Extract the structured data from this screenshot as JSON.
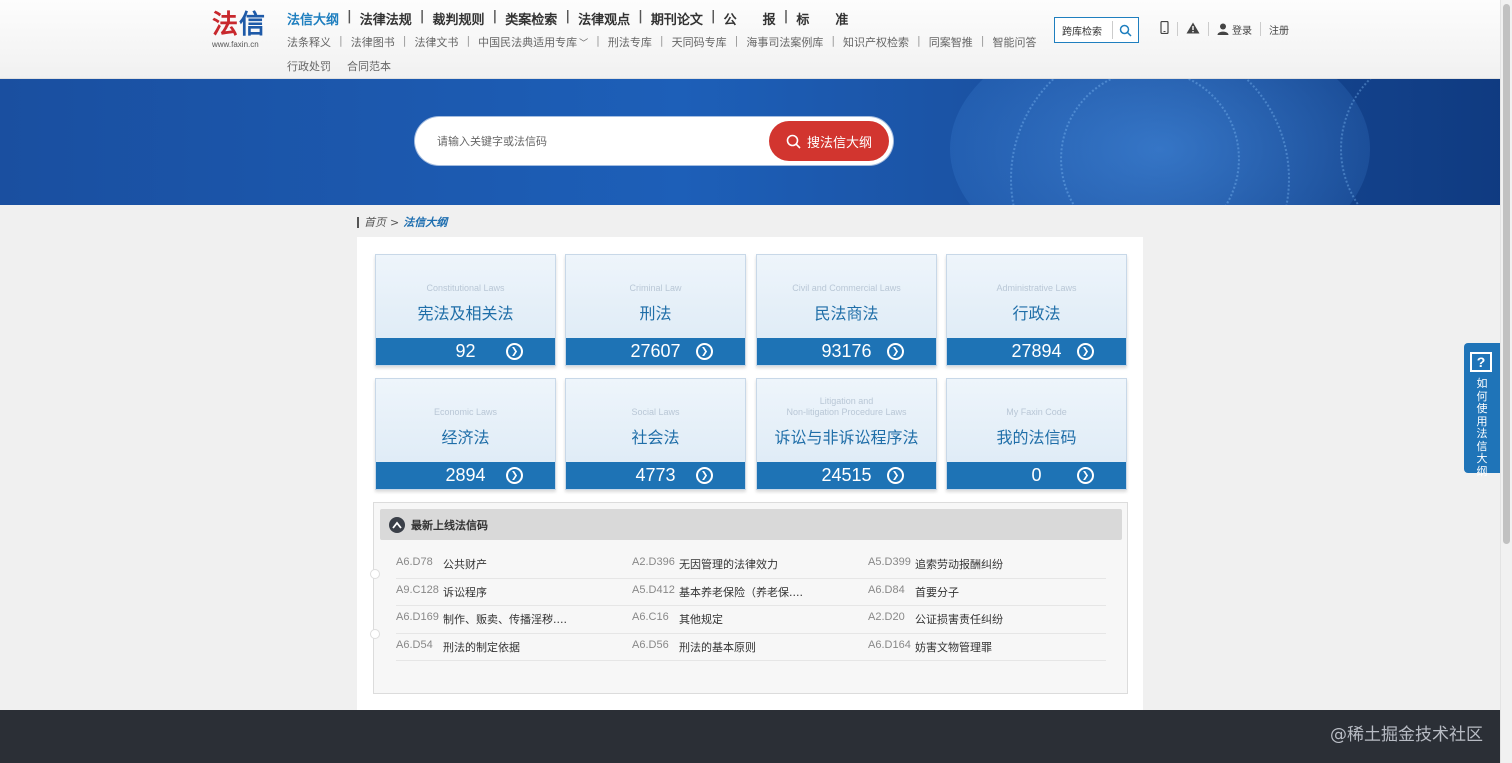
{
  "logo": {
    "main_fa": "法",
    "main_xin": "信",
    "sub": "www.faxin.cn"
  },
  "nav_main": [
    "法信大纲",
    "法律法规",
    "裁判规则",
    "类案检索",
    "法律观点",
    "期刊论文",
    "公　　报",
    "标　　准"
  ],
  "nav_sub": [
    "法条释义",
    "法律图书",
    "法律文书",
    "中国民法典适用专库",
    "刑法专库",
    "天同码专库",
    "海事司法案例库",
    "知识产权检索",
    "同案智推",
    "智能问答"
  ],
  "nav_sub2": [
    "行政处罚",
    "合同范本"
  ],
  "lib_search": {
    "label": "跨库检索"
  },
  "topright": {
    "login": "登录",
    "register": "注册"
  },
  "search": {
    "placeholder": "请输入关键字或法信码",
    "button": "搜法信大纲"
  },
  "breadcrumb": {
    "home": "首页",
    "sep": ">",
    "current": "法信大纲"
  },
  "categories": [
    {
      "en": "Constitutional Laws",
      "cn": "宪法及相关法",
      "count": "92"
    },
    {
      "en": "Criminal Law",
      "cn": "刑法",
      "count": "27607"
    },
    {
      "en": "Civil and Commercial Laws",
      "cn": "民法商法",
      "count": "93176"
    },
    {
      "en": "Administrative Laws",
      "cn": "行政法",
      "count": "27894"
    },
    {
      "en": "Economic Laws",
      "cn": "经济法",
      "count": "2894"
    },
    {
      "en": "Social Laws",
      "cn": "社会法",
      "count": "4773"
    },
    {
      "en": "Litigation and Non-litigation Procedure Laws",
      "en1": "Litigation and",
      "en2": "Non-litigation Procedure Laws",
      "cn": "诉讼与非诉讼程序法",
      "count": "24515"
    },
    {
      "en": "My Faxin Code",
      "cn": "我的法信码",
      "count": "0"
    }
  ],
  "latest": {
    "title": "最新上线法信码",
    "rows": [
      [
        {
          "code": "A6.D78",
          "text": "公共财产"
        },
        {
          "code": "A2.D396",
          "text": "无因管理的法律效力"
        },
        {
          "code": "A5.D399",
          "text": "追索劳动报酬纠纷"
        }
      ],
      [
        {
          "code": "A9.C128",
          "text": "诉讼程序"
        },
        {
          "code": "A5.D412",
          "text": "基本养老保险（养老保...."
        },
        {
          "code": "A6.D84",
          "text": "首要分子"
        }
      ],
      [
        {
          "code": "A6.D169",
          "text": "制作、贩卖、传播淫秽...."
        },
        {
          "code": "A6.C16",
          "text": "其他规定"
        },
        {
          "code": "A2.D20",
          "text": "公证损害责任纠纷"
        }
      ],
      [
        {
          "code": "A6.D54",
          "text": "刑法的制定依据"
        },
        {
          "code": "A6.D56",
          "text": "刑法的基本原则"
        },
        {
          "code": "A6.D164",
          "text": "妨害文物管理罪"
        }
      ]
    ]
  },
  "help_tab": {
    "q": "?",
    "text": "如何使用法信大纲"
  },
  "watermark": "@稀土掘金技术社区",
  "colors": {
    "brand_blue": "#1e73b5",
    "brand_red": "#d2352f",
    "nav_active": "#1f7fbf"
  }
}
